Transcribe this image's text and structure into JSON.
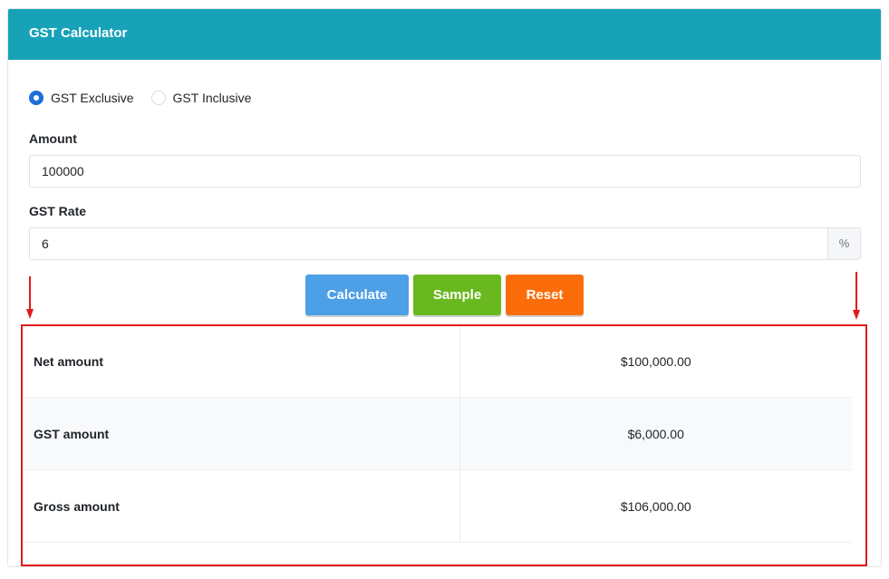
{
  "header": {
    "title": "GST Calculator"
  },
  "mode": {
    "options": [
      {
        "label": "GST Exclusive",
        "checked": true
      },
      {
        "label": "GST Inclusive",
        "checked": false
      }
    ]
  },
  "amount": {
    "label": "Amount",
    "value": "100000"
  },
  "gst_rate": {
    "label": "GST Rate",
    "value": "6",
    "suffix": "%"
  },
  "buttons": {
    "calculate": "Calculate",
    "sample": "Sample",
    "reset": "Reset"
  },
  "results": {
    "rows": [
      {
        "label": "Net amount",
        "value": "$100,000.00"
      },
      {
        "label": "GST amount",
        "value": "$6,000.00"
      },
      {
        "label": "Gross amount",
        "value": "$106,000.00"
      }
    ]
  },
  "colors": {
    "header": "#17a2b8",
    "calculate": "#4d9fe6",
    "sample": "#6ab81f",
    "reset": "#fb6d0b",
    "annotation": "#e01b1b"
  }
}
